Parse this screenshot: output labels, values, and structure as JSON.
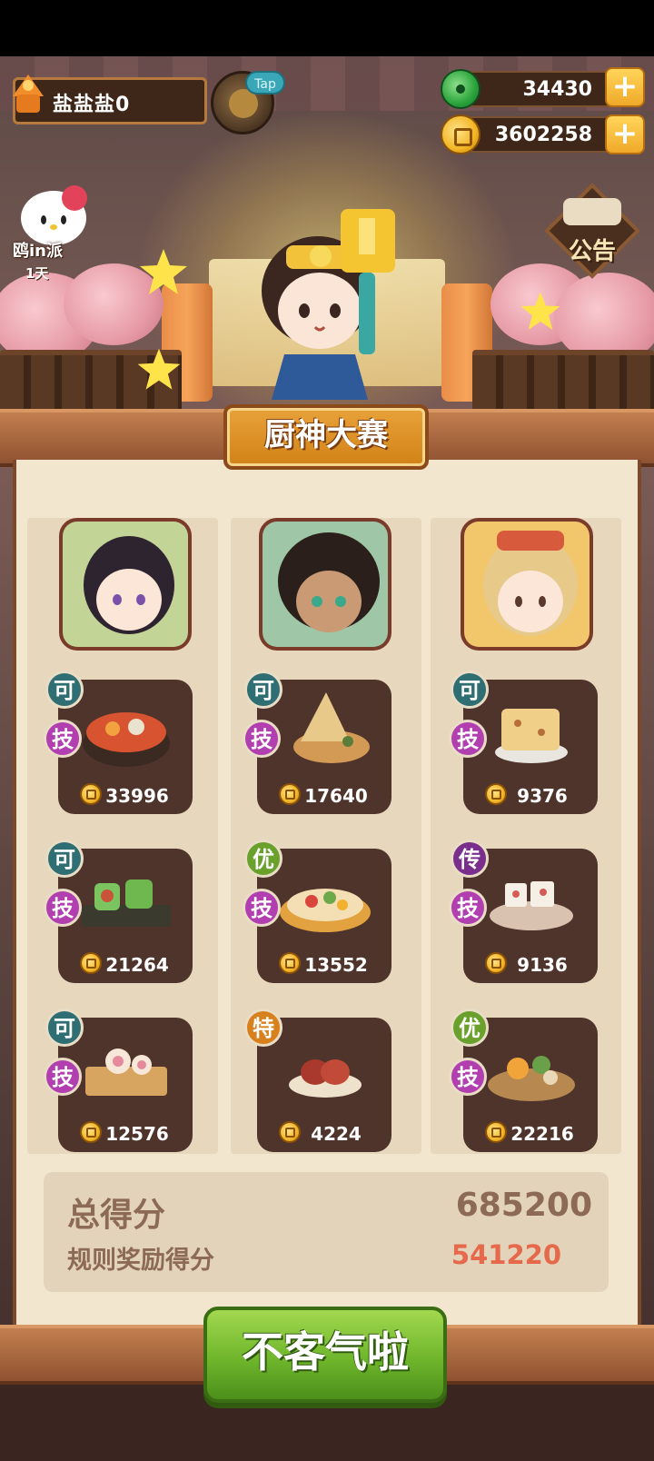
{
  "player": {
    "name": "盐盐盐0",
    "tap_label": "Tap"
  },
  "currency": {
    "jade": "34430",
    "coins": "3602258"
  },
  "side_event": {
    "label": "鸥in派",
    "sub": "1天"
  },
  "notice": {
    "label": "公告"
  },
  "contest": {
    "title": "厨神大赛"
  },
  "columns": [
    {
      "dishes": [
        {
          "badge": "可",
          "badge_type": "ke",
          "skill": "技",
          "value": "33996"
        },
        {
          "badge": "可",
          "badge_type": "ke",
          "skill": "技",
          "value": "21264"
        },
        {
          "badge": "可",
          "badge_type": "ke",
          "skill": "技",
          "value": "12576"
        }
      ]
    },
    {
      "dishes": [
        {
          "badge": "可",
          "badge_type": "ke",
          "skill": "技",
          "value": "17640"
        },
        {
          "badge": "优",
          "badge_type": "you",
          "skill": "技",
          "value": "13552"
        },
        {
          "badge": "特",
          "badge_type": "te",
          "skill": "",
          "value": "4224"
        }
      ]
    },
    {
      "dishes": [
        {
          "badge": "可",
          "badge_type": "ke",
          "skill": "技",
          "value": "9376"
        },
        {
          "badge": "传",
          "badge_type": "chuan",
          "skill": "技",
          "value": "9136"
        },
        {
          "badge": "优",
          "badge_type": "you",
          "skill": "技",
          "value": "22216"
        }
      ]
    }
  ],
  "score": {
    "total_label": "总得分",
    "total_value": "685200",
    "bonus_label": "规则奖励得分",
    "bonus_value": "541220"
  },
  "confirm_button": {
    "label": "不客气啦"
  },
  "colors": {
    "bonus": "#e5694a",
    "confirm": "#6fb62c",
    "title_plate": "#d18216"
  }
}
